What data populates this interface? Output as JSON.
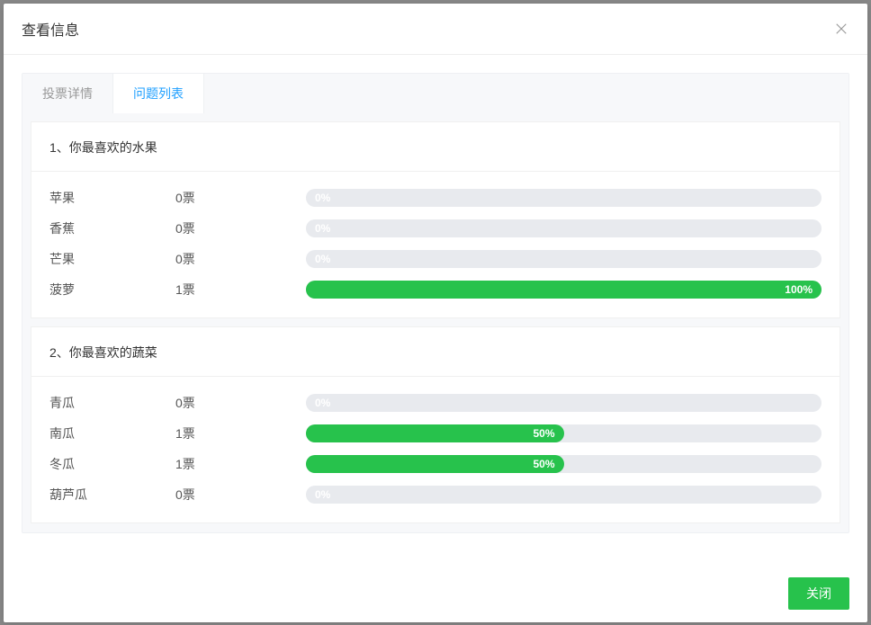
{
  "modal": {
    "title": "查看信息",
    "close_button": "关闭"
  },
  "tabs": [
    {
      "label": "投票详情",
      "active": false
    },
    {
      "label": "问题列表",
      "active": true
    }
  ],
  "vote_suffix": "票",
  "questions": [
    {
      "title": "1、你最喜欢的水果",
      "options": [
        {
          "name": "苹果",
          "count": 0,
          "percent": 0,
          "label": "0%"
        },
        {
          "name": "香蕉",
          "count": 0,
          "percent": 0,
          "label": "0%"
        },
        {
          "name": "芒果",
          "count": 0,
          "percent": 0,
          "label": "0%"
        },
        {
          "name": "菠萝",
          "count": 1,
          "percent": 100,
          "label": "100%"
        }
      ]
    },
    {
      "title": "2、你最喜欢的蔬菜",
      "options": [
        {
          "name": "青瓜",
          "count": 0,
          "percent": 0,
          "label": "0%"
        },
        {
          "name": "南瓜",
          "count": 1,
          "percent": 50,
          "label": "50%"
        },
        {
          "name": "冬瓜",
          "count": 1,
          "percent": 50,
          "label": "50%"
        },
        {
          "name": "葫芦瓜",
          "count": 0,
          "percent": 0,
          "label": "0%"
        }
      ]
    }
  ],
  "chart_data": [
    {
      "type": "bar",
      "title": "1、你最喜欢的水果",
      "categories": [
        "苹果",
        "香蕉",
        "芒果",
        "菠萝"
      ],
      "values": [
        0,
        0,
        0,
        100
      ],
      "counts": [
        0,
        0,
        0,
        1
      ],
      "xlabel": "",
      "ylabel": "percent",
      "ylim": [
        0,
        100
      ]
    },
    {
      "type": "bar",
      "title": "2、你最喜欢的蔬菜",
      "categories": [
        "青瓜",
        "南瓜",
        "冬瓜",
        "葫芦瓜"
      ],
      "values": [
        0,
        50,
        50,
        0
      ],
      "counts": [
        0,
        1,
        1,
        0
      ],
      "xlabel": "",
      "ylabel": "percent",
      "ylim": [
        0,
        100
      ]
    }
  ],
  "colors": {
    "primary_green": "#27c24c",
    "track_grey": "#e8eaee",
    "link_blue": "#1e9fff"
  }
}
